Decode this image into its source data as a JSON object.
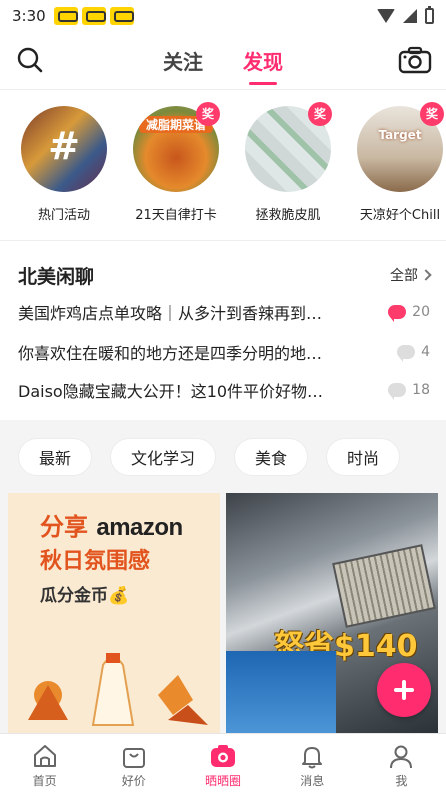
{
  "status_bar": {
    "time": "3:30"
  },
  "header": {
    "tabs": [
      {
        "label": "关注"
      },
      {
        "label": "发现"
      }
    ],
    "active_tab": "发现",
    "accent_color": "#ff2d6f"
  },
  "stories": [
    {
      "label": "热门活动",
      "icon": "hashtag-icon"
    },
    {
      "label": "21天自律打卡",
      "badge": "奖",
      "image_text": "减脂期菜谱"
    },
    {
      "label": "拯救脆皮肌",
      "badge": "奖"
    },
    {
      "label": "天凉好个Chill",
      "badge": "奖",
      "image_text": "Target"
    }
  ],
  "forum": {
    "title": "北美闲聊",
    "all_label": "全部",
    "topics": [
      {
        "text": "美国炸鸡店点单攻略｜从多汁到香辣再到…",
        "count": "20",
        "hot": true
      },
      {
        "text": "你喜欢住在暖和的地方还是四季分明的地…",
        "count": "4",
        "hot": false
      },
      {
        "text": "Daiso隐藏宝藏大公开！这10件平价好物…",
        "count": "18",
        "hot": false
      }
    ]
  },
  "chips": [
    "最新",
    "文化学习",
    "美食",
    "时尚"
  ],
  "feed": {
    "left_card": {
      "line1_prefix": "分享",
      "line1_brand": "amazon",
      "line2": "秋日氛围感",
      "line3": "瓜分金币💰"
    },
    "right_card": {
      "price_text": "怒省$140"
    }
  },
  "bottom_nav": [
    {
      "label": "首页",
      "icon": "home-icon"
    },
    {
      "label": "好价",
      "icon": "shopping-bag-icon"
    },
    {
      "label": "晒晒圈",
      "icon": "camera-icon",
      "active": true
    },
    {
      "label": "消息",
      "icon": "bell-icon"
    },
    {
      "label": "我",
      "icon": "person-icon"
    }
  ]
}
